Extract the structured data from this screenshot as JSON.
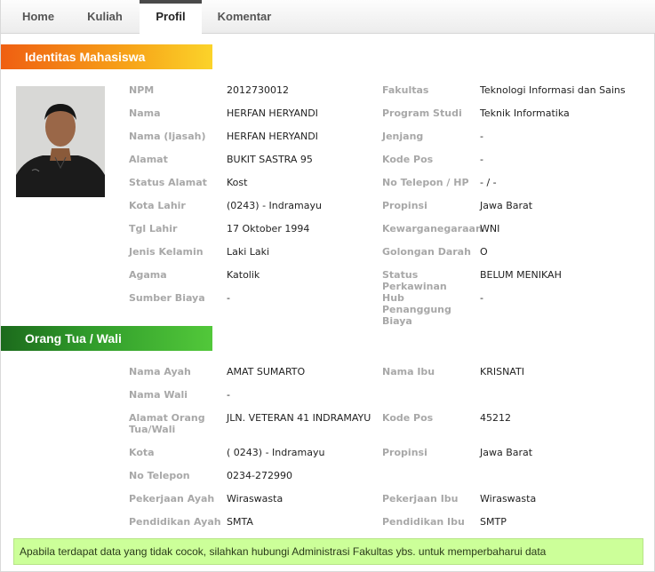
{
  "tabs": [
    {
      "label": "Home"
    },
    {
      "label": "Kuliah"
    },
    {
      "label": "Profil"
    },
    {
      "label": "Komentar"
    }
  ],
  "identitas": {
    "title": "Identitas Mahasiswa",
    "left": [
      {
        "label": "NPM",
        "value": "2012730012"
      },
      {
        "label": "Nama",
        "value": "HERFAN HERYANDI"
      },
      {
        "label": "Nama (Ijasah)",
        "value": "HERFAN HERYANDI"
      },
      {
        "label": "Alamat",
        "value": "BUKIT SASTRA 95"
      },
      {
        "label": "Status Alamat",
        "value": "Kost"
      },
      {
        "label": "Kota Lahir",
        "value": "(0243) - Indramayu"
      },
      {
        "label": "Tgl Lahir",
        "value": "17 Oktober 1994"
      },
      {
        "label": "Jenis Kelamin",
        "value": "Laki Laki"
      },
      {
        "label": "Agama",
        "value": "Katolik"
      },
      {
        "label": "Sumber Biaya",
        "value": "-"
      }
    ],
    "right": [
      {
        "label": "Fakultas",
        "value": "Teknologi Informasi dan Sains"
      },
      {
        "label": "Program Studi",
        "value": "Teknik Informatika"
      },
      {
        "label": "Jenjang",
        "value": "-"
      },
      {
        "label": "Kode Pos",
        "value": "-"
      },
      {
        "label": "No Telepon / HP",
        "value": "- / -"
      },
      {
        "label": "Propinsi",
        "value": "Jawa Barat"
      },
      {
        "label": "Kewarganegaraan",
        "value": "WNI"
      },
      {
        "label": "Golongan Darah",
        "value": "O"
      },
      {
        "label": "Status Perkawinan",
        "value": "BELUM MENIKAH"
      },
      {
        "label": "Hub Penanggung Biaya",
        "value": "-"
      }
    ]
  },
  "orangtua": {
    "title": "Orang Tua / Wali",
    "left": [
      {
        "label": "Nama Ayah",
        "value": "AMAT SUMARTO"
      },
      {
        "label": "Nama Wali",
        "value": "-"
      },
      {
        "label": "Alamat Orang Tua/Wali",
        "value": "JLN. VETERAN 41 INDRAMAYU"
      },
      {
        "label": "Kota",
        "value": "( 0243) - Indramayu"
      },
      {
        "label": "No Telepon",
        "value": "0234-272990"
      },
      {
        "label": "Pekerjaan Ayah",
        "value": "Wiraswasta"
      },
      {
        "label": "Pendidikan Ayah",
        "value": "SMTA"
      }
    ],
    "right": [
      {
        "label": "Nama Ibu",
        "value": "KRISNATI"
      },
      {
        "label": "Kode Pos",
        "value": "45212"
      },
      {
        "label": "Propinsi",
        "value": "Jawa Barat"
      },
      {
        "label": "Pekerjaan Ibu",
        "value": "Wiraswasta"
      },
      {
        "label": "Pendidikan Ibu",
        "value": "SMTP"
      }
    ]
  },
  "notice": "Apabila terdapat data yang tidak cocok, silahkan hubungi Administrasi Fakultas ybs. untuk memperbaharui data",
  "colors": {
    "notice_bg": "#ccff99",
    "bar_orange": "#f7a318",
    "bar_green": "#2f9a2a"
  }
}
